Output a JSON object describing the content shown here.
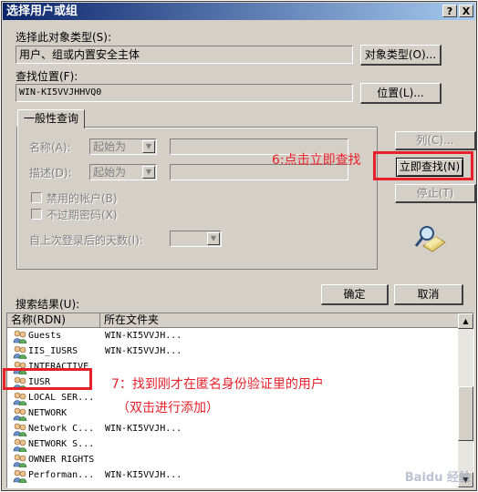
{
  "window": {
    "title": "选择用户或组",
    "help_button": "?",
    "close_button": "X"
  },
  "object_type": {
    "label": "选择此对象类型(S):",
    "value": "用户、组或内置安全主体",
    "button": "对象类型(O)..."
  },
  "location": {
    "label": "查找位置(F):",
    "value": "WIN-KI5VVJHHVQ0",
    "button": "位置(L)..."
  },
  "common_queries": {
    "tab_label": "一般性查询",
    "name_label": "名称(A):",
    "name_mode": "起始为",
    "desc_label": "描述(D):",
    "desc_mode": "起始为",
    "disabled_accounts": "禁用的帐户(B)",
    "non_expiring_pwd": "不过期密码(X)",
    "days_since_login": "自上次登录后的天数(I):"
  },
  "buttons": {
    "columns": "列(C)...",
    "find_now": "立即查找(N)",
    "stop": "停止(T)",
    "ok": "确定",
    "cancel": "取消"
  },
  "results": {
    "label": "搜索结果(U):",
    "columns": [
      "名称(RDN)",
      "所在文件夹"
    ],
    "rows": [
      {
        "name": "Guests",
        "folder": "WIN-KI5VVJH..."
      },
      {
        "name": "IIS_IUSRS",
        "folder": "WIN-KI5VVJH..."
      },
      {
        "name": "INTERACTIVE",
        "folder": ""
      },
      {
        "name": "IUSR",
        "folder": ""
      },
      {
        "name": "LOCAL SER...",
        "folder": ""
      },
      {
        "name": "NETWORK",
        "folder": ""
      },
      {
        "name": "Network C...",
        "folder": "WIN-KI5VVJH..."
      },
      {
        "name": "NETWORK S...",
        "folder": ""
      },
      {
        "name": "OWNER RIGHTS",
        "folder": ""
      },
      {
        "name": "Performan...",
        "folder": "WIN-KI5VVJH..."
      }
    ]
  },
  "annotations": {
    "step6": "6:点击立即查找",
    "step7_line1": "7：找到刚才在匿名身份验证里的用户",
    "step7_line2": "（双击进行添加）",
    "highlight_color": "#e8202a"
  },
  "watermark": "Baidu 经验"
}
